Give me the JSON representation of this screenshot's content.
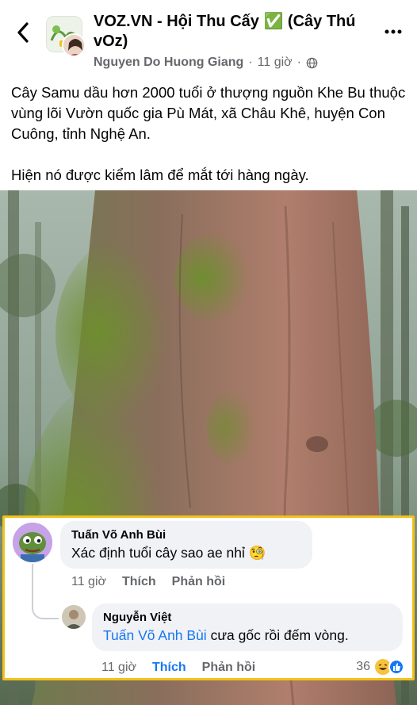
{
  "header": {
    "group_name": "VOZ.VN - Hội Thu Cấy ✅ (Cây Thú vOz)",
    "author": "Nguyen Do Huong Giang",
    "separator": "·",
    "time": "11 giờ",
    "icons": {
      "back": "chevron-left-icon",
      "more": "more-dots-icon",
      "privacy": "globe-icon"
    }
  },
  "post": {
    "paragraph1": "Cây Samu dầu hơn 2000 tuổi ở thượng nguồn Khe Bu thuộc vùng lõi Vườn quốc gia Pù Mát, xã Châu Khê, huyện Con Cuông, tỉnh Nghệ An.",
    "paragraph2": "Hiện nó được kiểm lâm để mắt tới hàng ngày."
  },
  "comments": [
    {
      "name": "Tuấn Võ Anh Bùi",
      "text": "Xác định tuổi cây sao ae nhỉ 🧐",
      "time": "11 giờ",
      "like": "Thích",
      "reply": "Phản hồi"
    },
    {
      "name": "Nguyễn Việt",
      "mention": "Tuấn Võ Anh Bùi",
      "text": " cưa gốc rồi đếm vòng.",
      "time": "11 giờ",
      "like": "Thích",
      "reply": "Phản hồi",
      "reaction_count": "36"
    }
  ],
  "colors": {
    "highlight_border": "#f2c21c",
    "link": "#1877f2",
    "secondary_text": "#65676b",
    "bubble": "#f0f2f5"
  }
}
